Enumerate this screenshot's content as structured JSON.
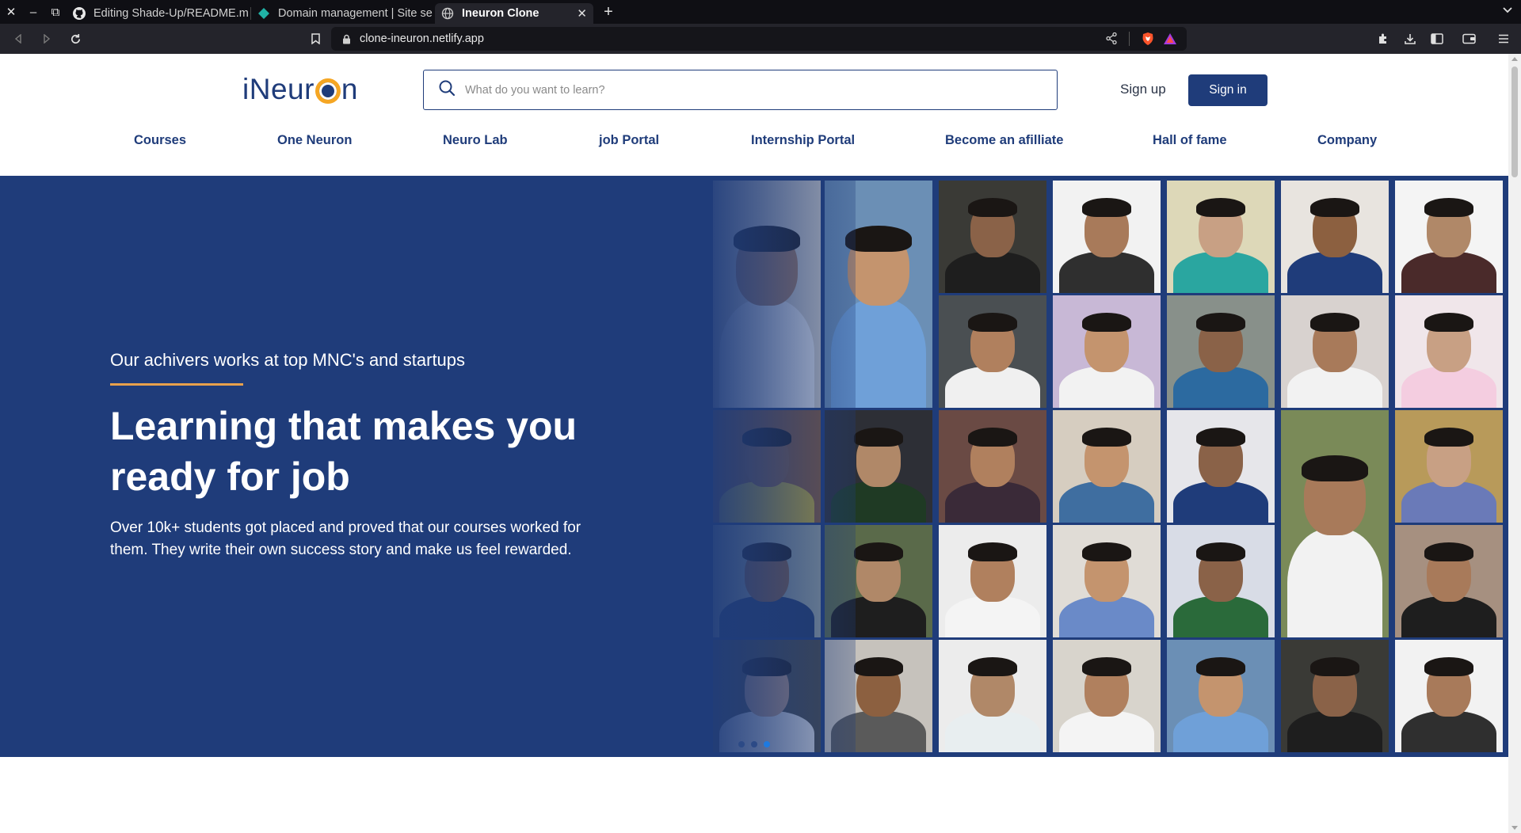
{
  "browser": {
    "tabs": [
      {
        "title": "Editing Shade-Up/README.m",
        "icon": "github-icon"
      },
      {
        "title": "Domain management | Site se",
        "icon": "netlify-icon"
      },
      {
        "title": "Ineuron Clone",
        "icon": "globe-icon",
        "active": true
      }
    ],
    "url": "clone-ineuron.netlify.app"
  },
  "header": {
    "logo_pre": "iNeur",
    "logo_post": "n",
    "search_placeholder": "What do you want to learn?",
    "signup_label": "Sign up",
    "signin_label": "Sign in"
  },
  "nav": {
    "items": [
      "Courses",
      "One Neuron",
      "Neuro Lab",
      "job Portal",
      "Internship Portal",
      "Become an afilliate",
      "Hall of fame",
      "Company"
    ]
  },
  "hero": {
    "kicker": "Our achivers works at top MNC's and startups",
    "title": "Learning that makes you ready for job",
    "description": "Over 10k+ students got placed and proved that our courses worked for them. They write their own success story and make us feel rewarded.",
    "carousel": {
      "slides": 3,
      "active_slide": 3
    }
  },
  "colors": {
    "brand": "#1f3c7a",
    "accent": "#e8a14c",
    "active_dot": "#1e7ae0"
  }
}
